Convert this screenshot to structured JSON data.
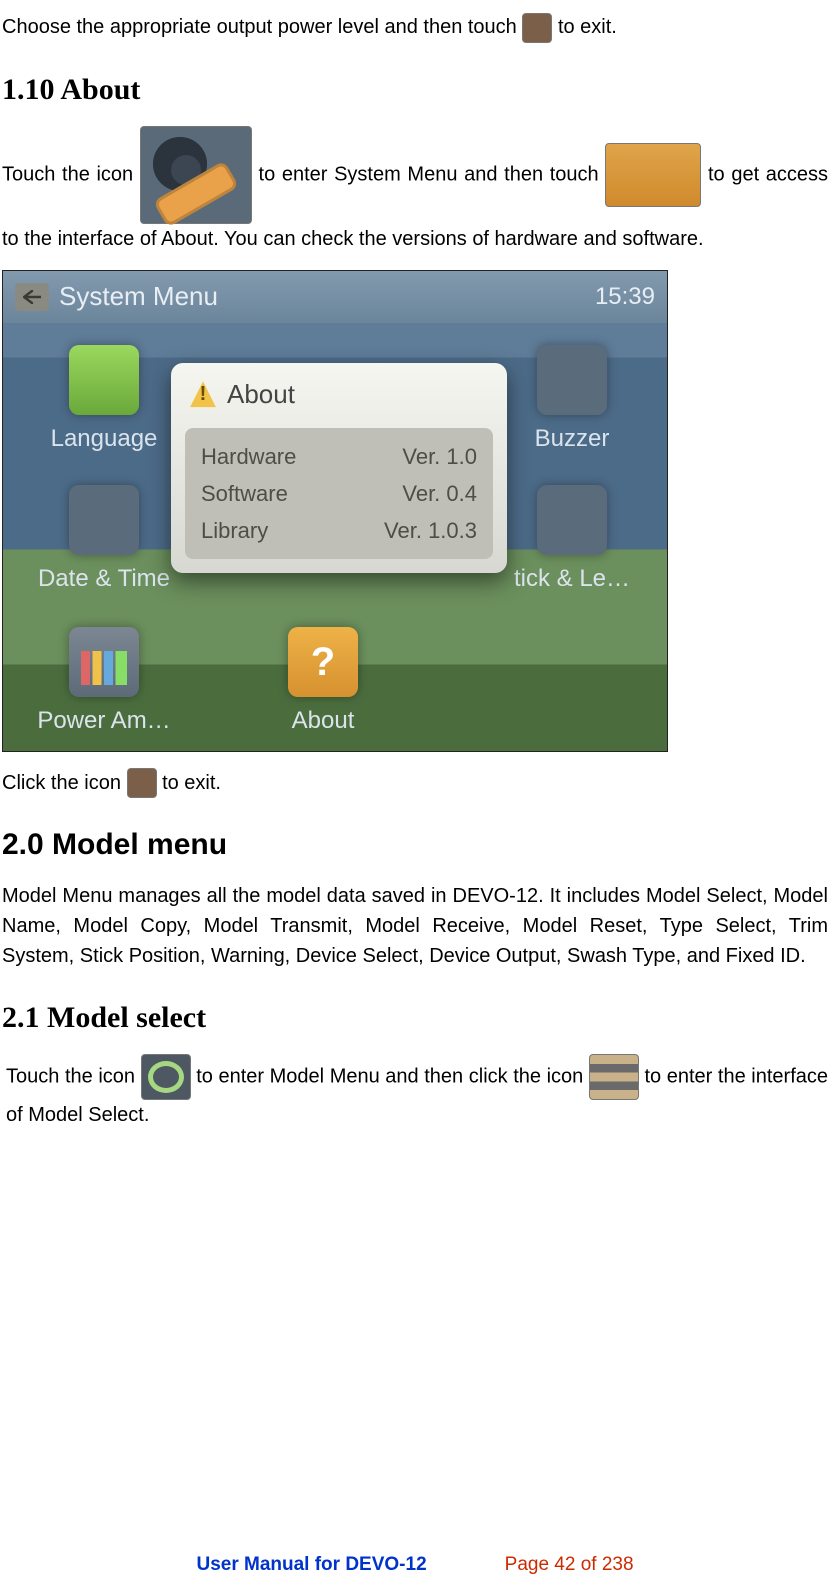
{
  "intro": {
    "p1_a": "Choose the appropriate output power level and then touch ",
    "p1_b": " to exit."
  },
  "s110": {
    "heading": "1.10 About",
    "p2_a": "Touch the icon ",
    "p2_b": " to enter System Menu and then touch ",
    "p2_c": " to get access to the interface of About. You can check the versions of hardware and software.",
    "p3_a": "Click the icon ",
    "p3_b": " to exit."
  },
  "screenshot": {
    "title": "System Menu",
    "clock": "15:39",
    "items": {
      "language": "Language",
      "buzzer": "Buzzer",
      "datetime": "Date & Time",
      "stick": "tick & Le…",
      "power": "Power Am…",
      "about": "About"
    },
    "dialog": {
      "title": "About",
      "rows": [
        {
          "label": "Hardware",
          "value": "Ver. 1.0"
        },
        {
          "label": "Software",
          "value": "Ver. 0.4"
        },
        {
          "label": "Library",
          "value": "Ver. 1.0.3"
        }
      ]
    }
  },
  "s20": {
    "heading": "2.0 Model menu",
    "p": "Model Menu manages all the model data saved in DEVO-12. It includes Model Select, Model Name, Model Copy, Model Transmit, Model Receive, Model Reset, Type Select, Trim System, Stick Position, Warning, Device Select, Device Output, Swash Type, and Fixed ID."
  },
  "s21": {
    "heading": "2.1 Model select",
    "p_a": "Touch the icon ",
    "p_b": " to enter Model Menu and then click the icon ",
    "p_c": " to enter the interface of Model Select."
  },
  "footer": {
    "left": "User Manual for DEVO-12",
    "right": "Page 42 of 238"
  }
}
